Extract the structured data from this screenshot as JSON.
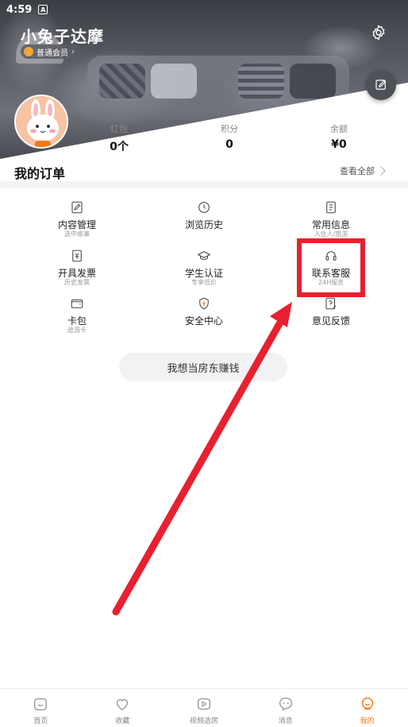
{
  "status_bar": {
    "time": "4:59",
    "notification_badge": "A"
  },
  "profile": {
    "username": "小兔子达摩",
    "membership": "普通会员"
  },
  "stats": [
    {
      "label": "红包",
      "value": "0个"
    },
    {
      "label": "积分",
      "value": "0"
    },
    {
      "label": "余额",
      "value": "¥0"
    }
  ],
  "orders": {
    "title": "我的订单",
    "view_all": "查看全部"
  },
  "grid": [
    {
      "title": "内容管理",
      "subtitle": "选中故事",
      "icon": "edit-doc-icon"
    },
    {
      "title": "浏览历史",
      "subtitle": "",
      "icon": "clock-icon"
    },
    {
      "title": "常用信息",
      "subtitle": "入住人/旅游",
      "icon": "notebook-icon"
    },
    {
      "title": "开具发票",
      "subtitle": "历史发票",
      "icon": "invoice-icon"
    },
    {
      "title": "学生认证",
      "subtitle": "专享低价",
      "icon": "graduation-cap-icon"
    },
    {
      "title": "联系客服",
      "subtitle": "24H服务",
      "icon": "headset-icon"
    },
    {
      "title": "卡包",
      "subtitle": "途游卡",
      "icon": "wallet-icon"
    },
    {
      "title": "安全中心",
      "subtitle": "",
      "icon": "shield-icon"
    },
    {
      "title": "意见反馈",
      "subtitle": "",
      "icon": "feedback-icon"
    }
  ],
  "landlord_button": "我想当房东赚钱",
  "bottom_nav": [
    {
      "label": "首页",
      "icon": "home-icon",
      "active": false
    },
    {
      "label": "收藏",
      "icon": "heart-icon",
      "active": false
    },
    {
      "label": "视频选房",
      "icon": "video-icon",
      "active": false
    },
    {
      "label": "消息",
      "icon": "message-icon",
      "active": false
    },
    {
      "label": "我的",
      "icon": "profile-icon",
      "active": true
    }
  ],
  "colors": {
    "accent": "#f07a1a",
    "annotation_red": "#e8202f",
    "muted_text": "#888888"
  }
}
